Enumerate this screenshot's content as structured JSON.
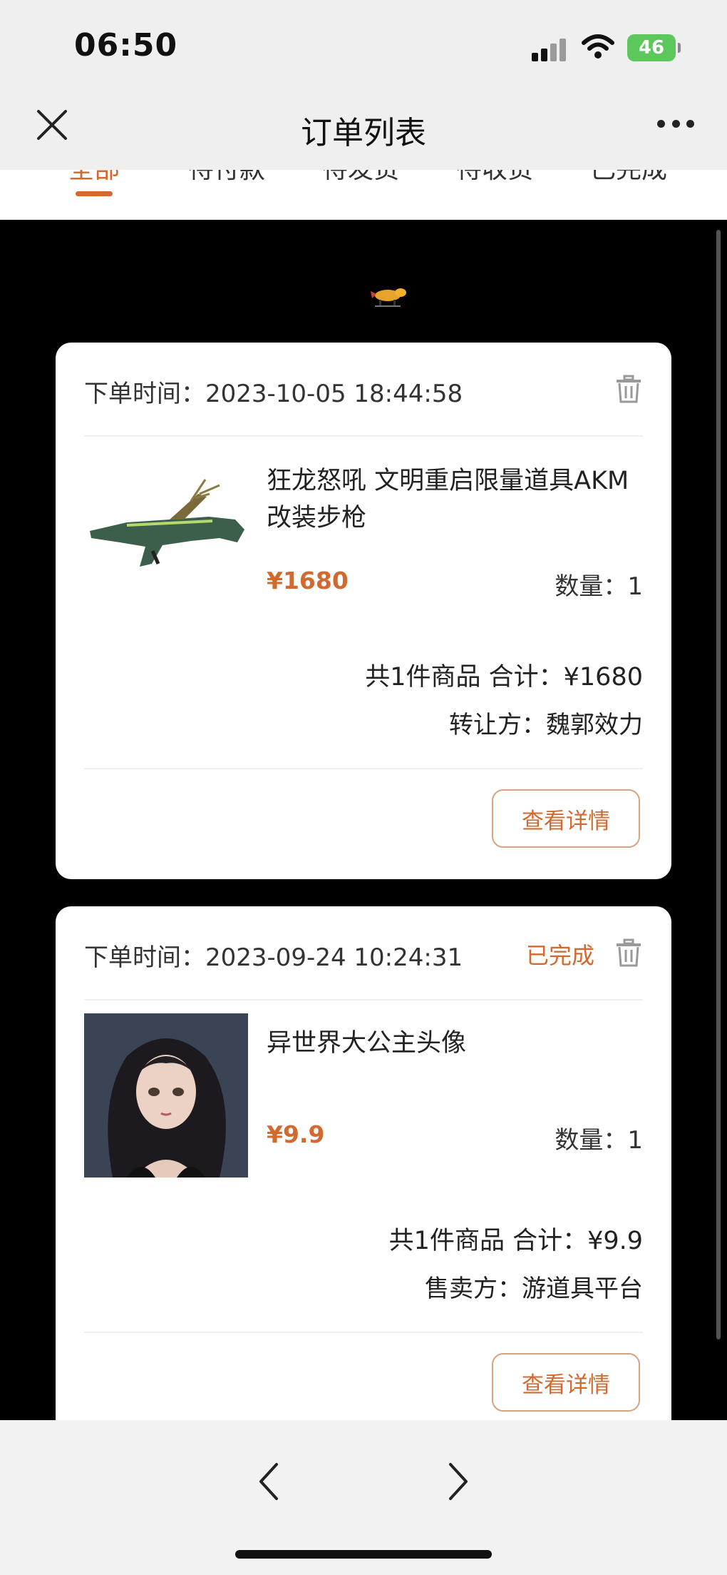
{
  "status_bar": {
    "time": "06:50",
    "battery": "46"
  },
  "header": {
    "title": "订单列表"
  },
  "tabs": [
    {
      "label": "全部",
      "active": true
    },
    {
      "label": "待付款"
    },
    {
      "label": "待发货"
    },
    {
      "label": "待收货"
    },
    {
      "label": "已完成"
    }
  ],
  "orders": [
    {
      "time_label": "下单时间：",
      "time": "2023-10-05 18:44:58",
      "status": "",
      "product_name": "狂龙怒吼 文明重启限量道具AKM改装步枪",
      "price": "¥1680",
      "quantity": "数量：1",
      "total": "共1件商品 合计：¥1680",
      "party": "转让方：魏郭效力",
      "detail_button": "查看详情",
      "thumbnail": "rifle-image"
    },
    {
      "time_label": "下单时间：",
      "time": "2023-09-24 10:24:31",
      "status": "已完成",
      "product_name": "异世界大公主头像",
      "price": "¥9.9",
      "quantity": "数量：1",
      "total": "共1件商品 合计：¥9.9",
      "party": "售卖方：游道具平台",
      "detail_button": "查看详情",
      "thumbnail": "princess-avatar-image"
    }
  ],
  "colors": {
    "accent": "#d2692f",
    "page_bg": "#000000",
    "card_bg": "#ffffff"
  }
}
